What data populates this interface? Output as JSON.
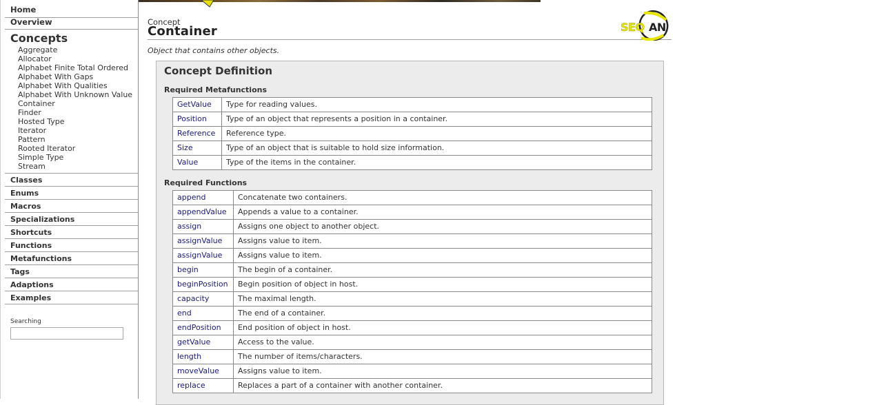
{
  "sidebar": {
    "home": "Home",
    "overview": "Overview",
    "concepts_heading": "Concepts",
    "concepts": [
      "Aggregate",
      "Allocator",
      "Alphabet Finite Total Ordered",
      "Alphabet With Gaps",
      "Alphabet With Qualities",
      "Alphabet With Unknown Value",
      "Container",
      "Finder",
      "Hosted Type",
      "Iterator",
      "Pattern",
      "Rooted Iterator",
      "Simple Type",
      "Stream"
    ],
    "sections": [
      "Classes",
      "Enums",
      "Macros",
      "Specializations",
      "Shortcuts",
      "Functions",
      "Metafunctions",
      "Tags",
      "Adaptions",
      "Examples"
    ],
    "search_label": "Searching",
    "search_value": ""
  },
  "page": {
    "kicker": "Concept",
    "title": "Container",
    "summary": "Object that contains other objects.",
    "logo_text": "SEQAN"
  },
  "definition": {
    "title": "Concept Definition",
    "metafunctions_heading": "Required Metafunctions",
    "metafunctions": [
      {
        "name": "GetValue",
        "desc": "Type for reading values."
      },
      {
        "name": "Position",
        "desc": "Type of an object that represents a position in a container."
      },
      {
        "name": "Reference",
        "desc": "Reference type."
      },
      {
        "name": "Size",
        "desc": "Type of an object that is suitable to hold size information."
      },
      {
        "name": "Value",
        "desc": "Type of the items in the container."
      }
    ],
    "functions_heading": "Required Functions",
    "functions": [
      {
        "name": "append",
        "desc": "Concatenate two containers."
      },
      {
        "name": "appendValue",
        "desc": "Appends a value to a container."
      },
      {
        "name": "assign",
        "desc": "Assigns one object to another object."
      },
      {
        "name": "assignValue",
        "desc": "Assigns value to item."
      },
      {
        "name": "assignValue",
        "desc": "Assigns value to item."
      },
      {
        "name": "begin",
        "desc": "The begin of a container."
      },
      {
        "name": "beginPosition",
        "desc": "Begin position of object in host."
      },
      {
        "name": "capacity",
        "desc": "The maximal length."
      },
      {
        "name": "end",
        "desc": "The end of a container."
      },
      {
        "name": "endPosition",
        "desc": "End position of object in host."
      },
      {
        "name": "getValue",
        "desc": "Access to the value."
      },
      {
        "name": "length",
        "desc": "The number of items/characters."
      },
      {
        "name": "moveValue",
        "desc": "Assigns value to item."
      },
      {
        "name": "replace",
        "desc": "Replaces a part of a container with another container."
      }
    ]
  },
  "colors": {
    "link": "#1a1a7a",
    "box_bg": "#ececec",
    "logo_yellow": "#e6e600"
  }
}
